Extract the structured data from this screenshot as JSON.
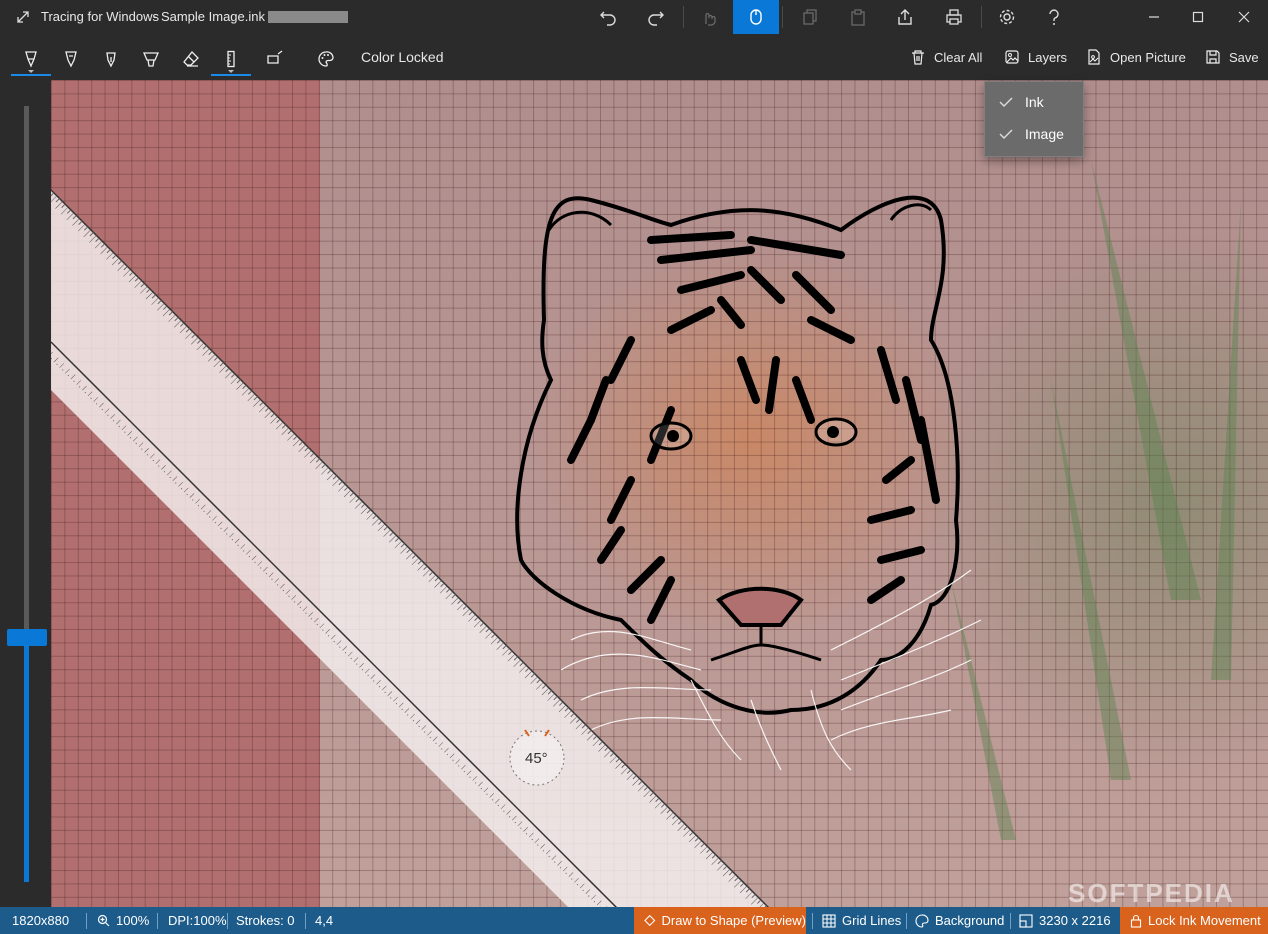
{
  "window": {
    "title": "Tracing for Windows",
    "document": " - Sample Image.ink"
  },
  "toolbar": {
    "status_label": "Color Locked",
    "actions": {
      "clear_all": "Clear All",
      "layers": "Layers",
      "open_picture": "Open Picture",
      "save": "Save"
    }
  },
  "layers_menu": {
    "items": [
      {
        "label": "Ink",
        "checked": true
      },
      {
        "label": "Image",
        "checked": true
      }
    ]
  },
  "ruler": {
    "angle_label": "45°"
  },
  "status": {
    "canvas_size": "1820x880",
    "zoom": "100%",
    "dpi": "DPI:100%",
    "strokes": "Strokes: 0",
    "position": "4,4",
    "draw_to_shape": "Draw to Shape (Preview)",
    "grid_lines": "Grid Lines",
    "background": "Background",
    "image_size": "3230 x 2216",
    "lock_ink": "Lock Ink Movement"
  },
  "watermark": "SOFTPEDIA",
  "colors": {
    "accent": "#0a78d7",
    "status_bar": "#1c5b8a",
    "status_highlight": "#d9621c",
    "chrome": "#2b2b2b"
  }
}
